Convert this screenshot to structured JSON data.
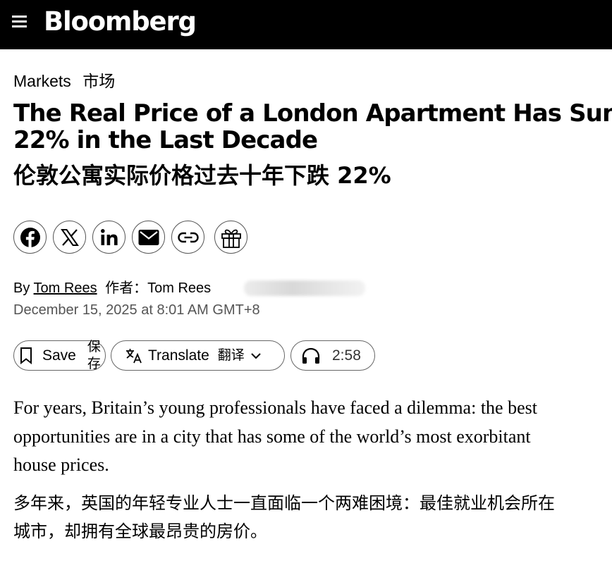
{
  "header": {
    "menu_icon": "hamburger-menu-icon",
    "logo_text": "Bloomberg"
  },
  "article": {
    "section": "Markets",
    "section_cn": "市场",
    "headline_lines": [
      "The Real Price of a London Apartment Has Sunk",
      "22% in the Last Decade"
    ],
    "headline_cn": "伦敦公寓实际价格过去十年下跌 22%",
    "share_icons": [
      "facebook-icon",
      "x-icon",
      "linkedin-icon",
      "email-icon",
      "link-icon",
      "gift-icon"
    ],
    "byline_prefix": "By",
    "author": "Tom Rees",
    "author_cn_prefix": "作者：",
    "author_repeat": "Tom Rees",
    "date": "December 15, 2025 at 8:01 AM GMT+8",
    "actions": {
      "save_label": "Save",
      "save_cn_line1": "保",
      "save_cn_line2": "存",
      "translate_label": "Translate",
      "translate_cn": "翻译",
      "listen_duration": "2:58"
    },
    "body_en_lines": [
      "For years, Britain’s young professionals have faced a dilemma: the best",
      "opportunities are in a city that has some of the world’s most exorbitant",
      "house prices."
    ],
    "body_cn_lines": [
      "多年来，英国的年轻专业人士一直面临一个两难困境：最佳就业机会所在",
      "城市，却拥有全球最昂贵的房价。"
    ]
  },
  "colors": {
    "header_bg": "#000000",
    "text": "#000000",
    "date_text": "#555555",
    "border": "#666666"
  }
}
